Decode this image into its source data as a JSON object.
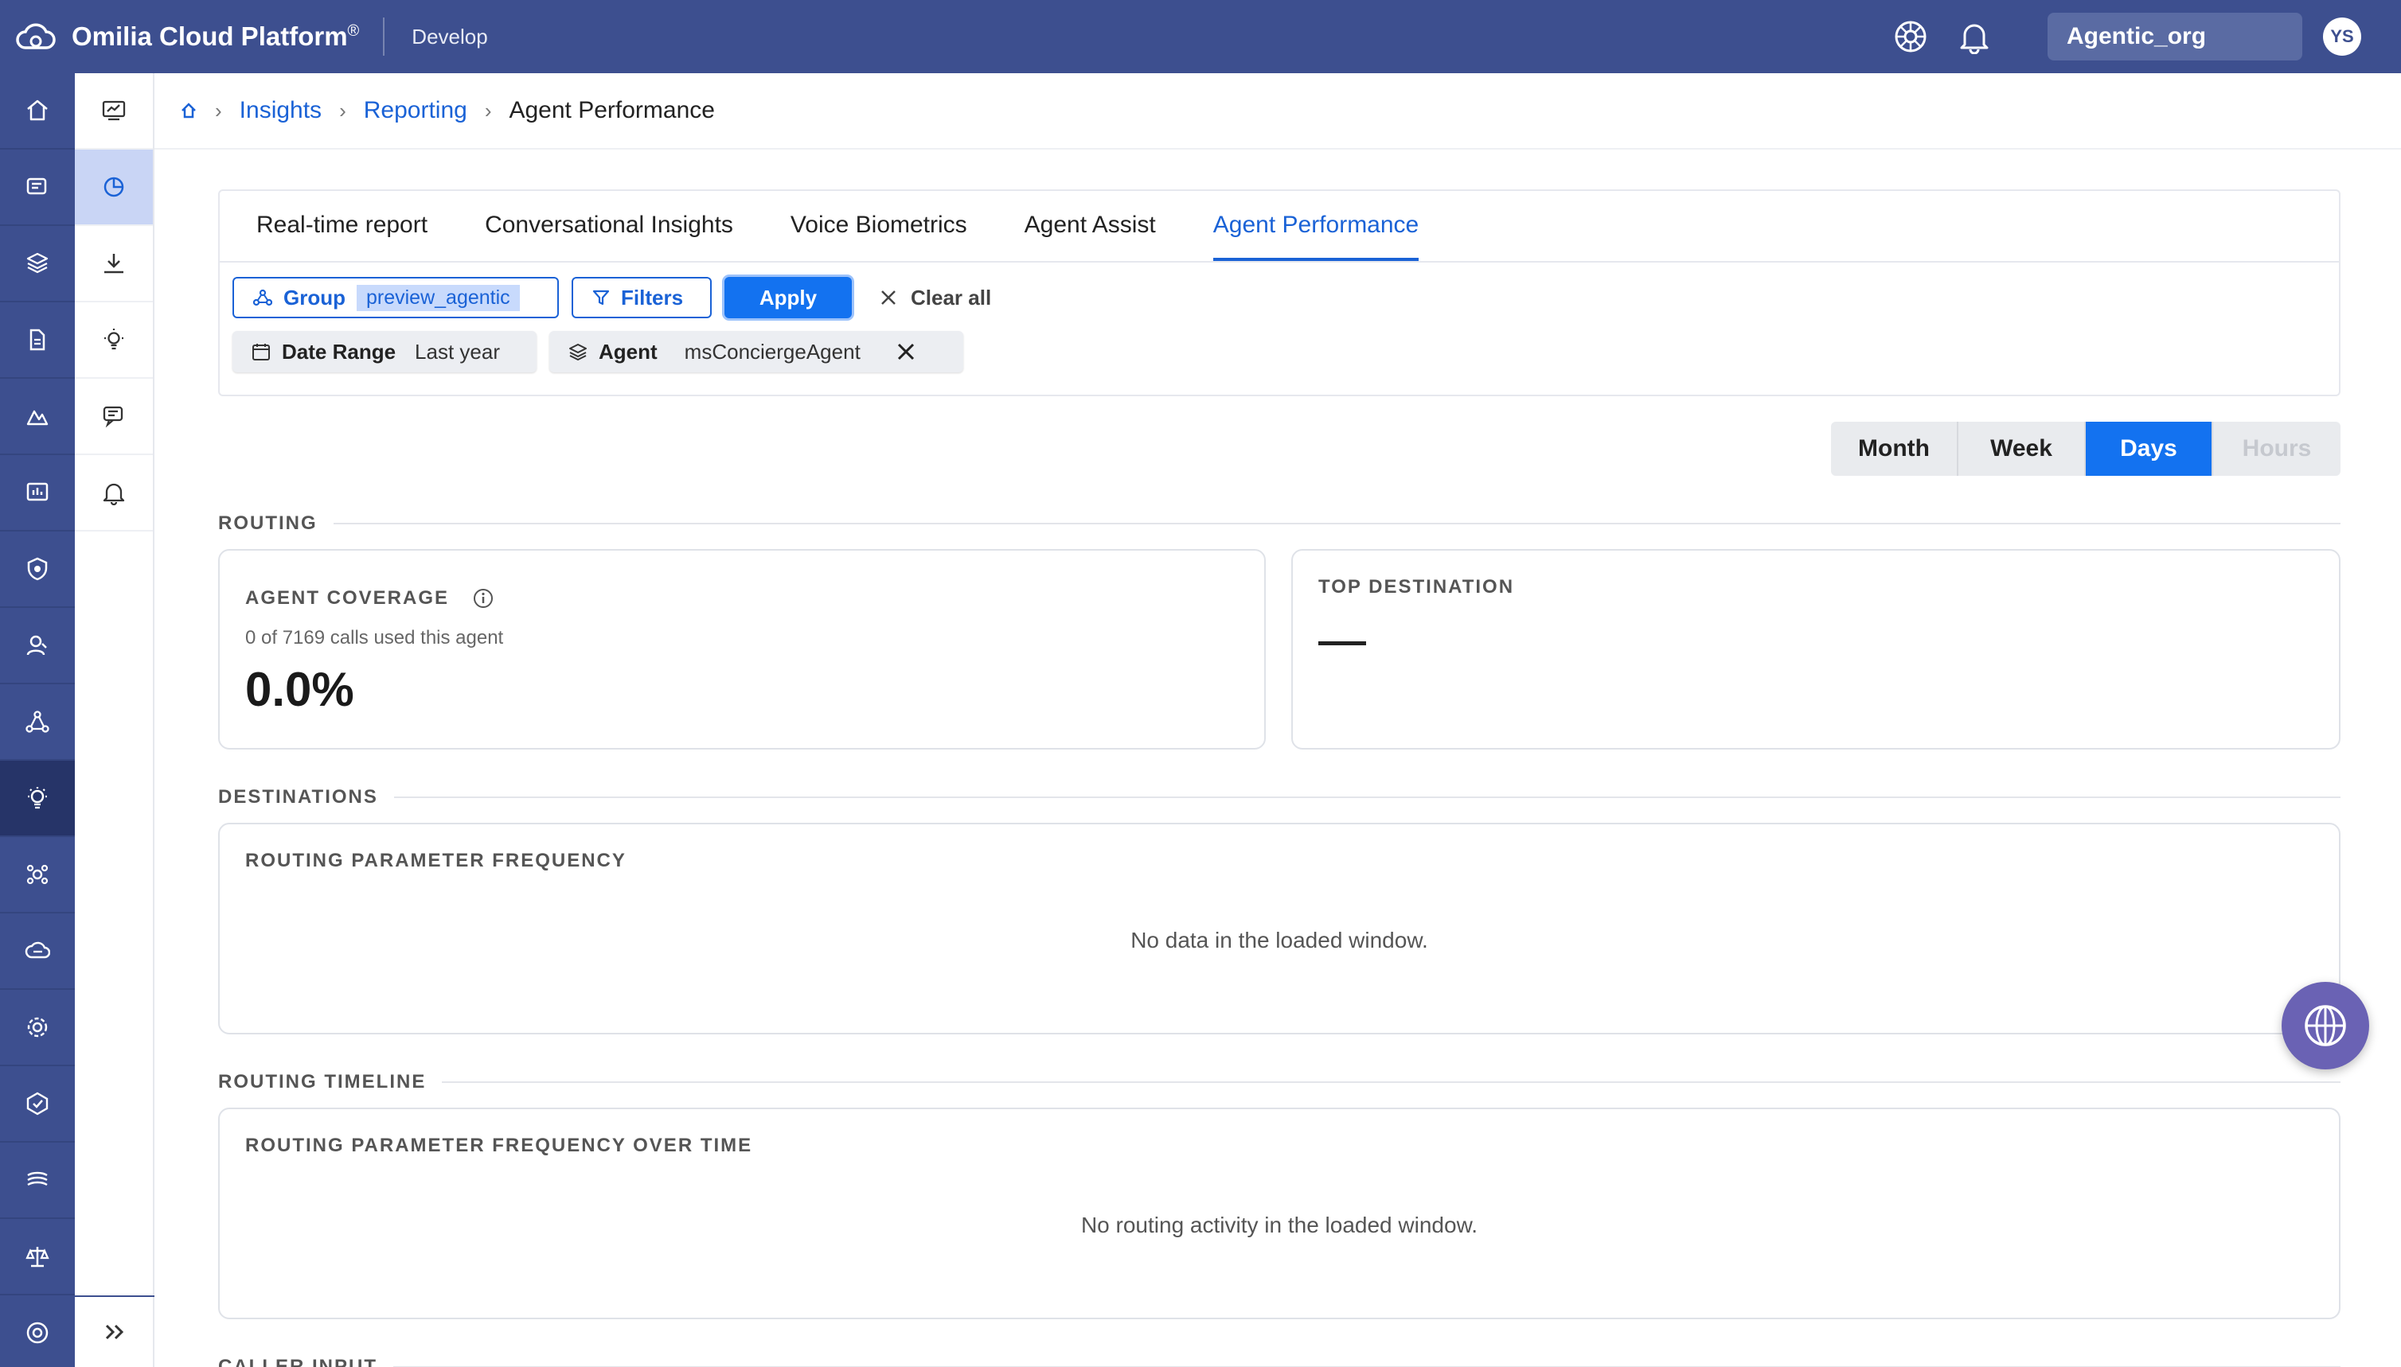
{
  "topbar": {
    "brand": "Omilia Cloud Platform",
    "brand_mark": "®",
    "environment": "Develop",
    "org": "Agentic_org",
    "avatar_initials": "YS"
  },
  "rail": {
    "icons": [
      "home-icon",
      "agents-icon",
      "layers-icon",
      "documents-icon",
      "insights-icon",
      "monitor-icon",
      "security-icon",
      "users-icon",
      "network-icon",
      "ideas-icon",
      "integrations-icon",
      "cloud-icon",
      "settings-icon",
      "compliance-icon",
      "models-icon",
      "balance-icon",
      "support-icon"
    ],
    "active_index": 9
  },
  "subnav": {
    "icons": [
      "dashboard-icon",
      "reporting-icon",
      "download-icon",
      "insights-bulb-icon",
      "conversations-icon",
      "alerts-icon"
    ],
    "active_index": 1
  },
  "breadcrumb": {
    "items": [
      "Insights",
      "Reporting"
    ],
    "current": "Agent Performance"
  },
  "tabs": [
    "Real-time report",
    "Conversational Insights",
    "Voice Biometrics",
    "Agent Assist",
    "Agent Performance"
  ],
  "active_tab": 4,
  "filters": {
    "group_label": "Group",
    "group_value": "preview_agentic",
    "filters_label": "Filters",
    "apply_label": "Apply",
    "clear_label": "Clear all",
    "date_range_label": "Date Range",
    "date_range_value": "Last year",
    "agent_label": "Agent",
    "agent_value": "msConciergeAgent"
  },
  "granularity": {
    "options": [
      "Month",
      "Week",
      "Days",
      "Hours"
    ],
    "active": "Days",
    "disabled": "Hours"
  },
  "routing": {
    "section": "ROUTING",
    "coverage_title": "AGENT COVERAGE",
    "coverage_sub": "0 of 7169 calls used this agent",
    "coverage_value": "0.0%",
    "top_dest_title": "TOP DESTINATION",
    "top_dest_value": "—"
  },
  "destinations": {
    "section": "DESTINATIONS",
    "card_title": "ROUTING PARAMETER FREQUENCY",
    "empty": "No data in the loaded window."
  },
  "timeline": {
    "section": "ROUTING TIMELINE",
    "card_title": "ROUTING PARAMETER FREQUENCY OVER TIME",
    "empty": "No routing activity in the loaded window."
  },
  "caller_input": {
    "section": "CALLER INPUT"
  },
  "colors": {
    "topbar": "#3d4f8f",
    "accent": "#1372f0",
    "link": "#1a62d6"
  }
}
